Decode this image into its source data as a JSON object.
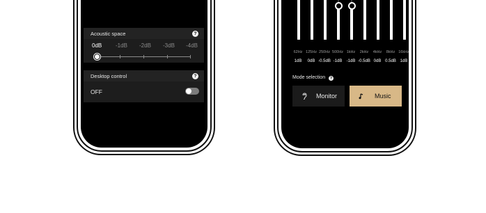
{
  "left_panel": {
    "acoustic_space": {
      "title": "Acoustic space",
      "levels": [
        "0dB",
        "-1dB",
        "-2dB",
        "-3dB",
        "-4dB"
      ],
      "selected_level": "0dB"
    },
    "desktop_control": {
      "title": "Desktop control",
      "state_label": "OFF",
      "enabled": false
    },
    "top_slider_level": 1.0
  },
  "right_panel": {
    "equalizer": {
      "bands": [
        {
          "freq": "62Hz",
          "gain": "1dB",
          "value": 1
        },
        {
          "freq": "125Hz",
          "gain": "0dB",
          "value": 0
        },
        {
          "freq": "250Hz",
          "gain": "-0.5dB",
          "value": -0.5
        },
        {
          "freq": "500Hz",
          "gain": "-1dB",
          "value": -1
        },
        {
          "freq": "1kHz",
          "gain": "-1dB",
          "value": -1
        },
        {
          "freq": "2kHz",
          "gain": "-0.5dB",
          "value": -0.5
        },
        {
          "freq": "4kHz",
          "gain": "0dB",
          "value": 0
        },
        {
          "freq": "8kHz",
          "gain": "0.5dB",
          "value": 0.5
        },
        {
          "freq": "16kHz",
          "gain": "1dB",
          "value": 1
        }
      ]
    },
    "mode_selection": {
      "label": "Mode selection",
      "options": [
        {
          "label": "Monitor",
          "icon": "ear-icon",
          "selected": false
        },
        {
          "label": "Music",
          "icon": "music-note-icon",
          "selected": true
        }
      ],
      "accent_color": "#d8b887"
    }
  }
}
